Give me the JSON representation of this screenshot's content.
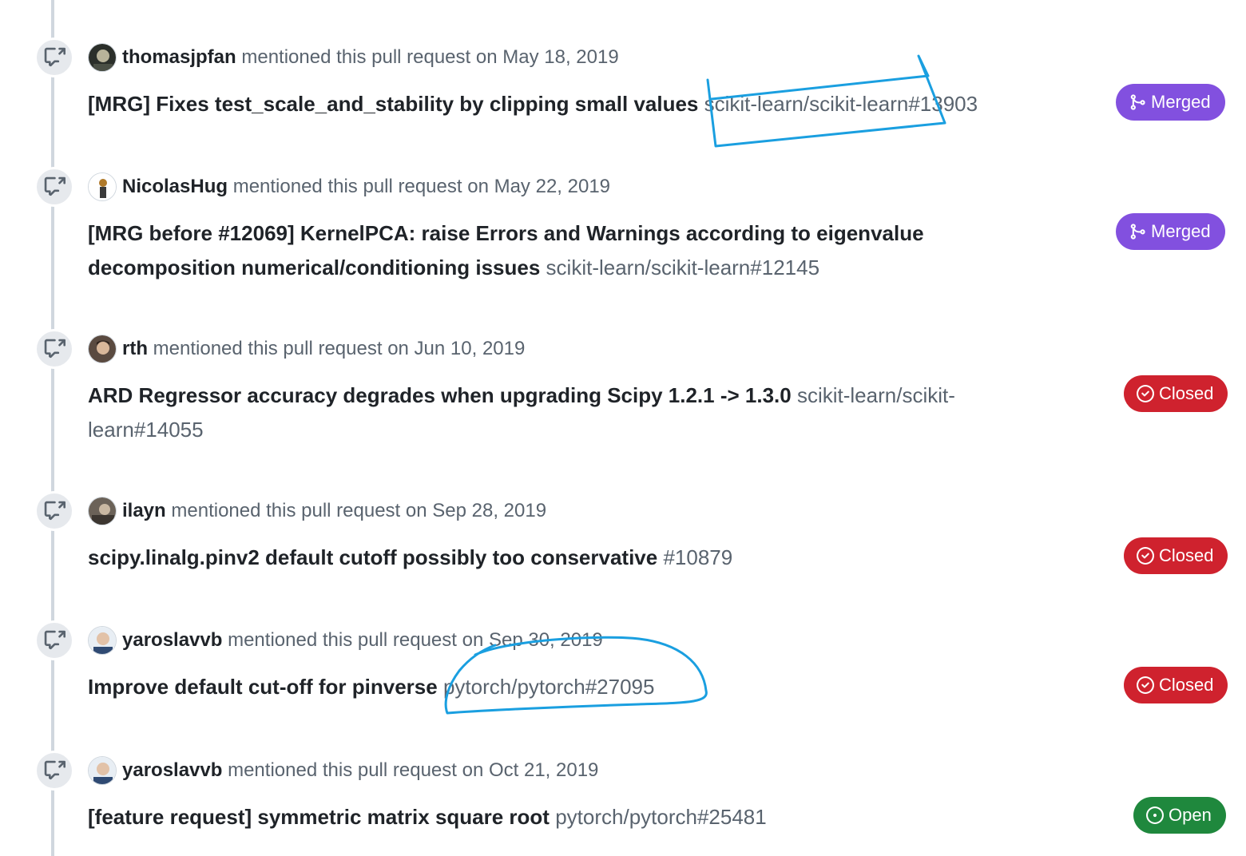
{
  "events": [
    {
      "author": "thomasjpfan",
      "action": "mentioned this pull request",
      "date": "on May 18, 2019",
      "title": "[MRG] Fixes test_scale_and_stability by clipping small values",
      "ref": "scikit-learn/scikit-learn#13903",
      "state": "Merged"
    },
    {
      "author": "NicolasHug",
      "action": "mentioned this pull request",
      "date": "on May 22, 2019",
      "title": "[MRG before #12069] KernelPCA: raise Errors and Warnings according to eigenvalue decomposition numerical/conditioning issues",
      "ref": "scikit-learn/scikit-learn#12145",
      "state": "Merged"
    },
    {
      "author": "rth",
      "action": "mentioned this pull request",
      "date": "on Jun 10, 2019",
      "title": "ARD Regressor accuracy degrades when upgrading Scipy 1.2.1 -> 1.3.0",
      "ref": "scikit-learn/scikit-learn#14055",
      "state": "Closed"
    },
    {
      "author": "ilayn",
      "action": "mentioned this pull request",
      "date": "on Sep 28, 2019",
      "title": "scipy.linalg.pinv2 default cutoff possibly too conservative",
      "ref": "#10879",
      "state": "Closed"
    },
    {
      "author": "yaroslavvb",
      "action": "mentioned this pull request",
      "date": "on Sep 30, 2019",
      "title": "Improve default cut-off for pinverse",
      "ref": "pytorch/pytorch#27095",
      "state": "Closed"
    },
    {
      "author": "yaroslavvb",
      "action": "mentioned this pull request",
      "date": "on Oct 21, 2019",
      "title": "[feature request] symmetric matrix square root",
      "ref": "pytorch/pytorch#25481",
      "state": "Open"
    }
  ],
  "icons": {
    "event": "cross-reference-icon",
    "merged": "git-merge-icon",
    "closed": "issue-closed-icon",
    "open": "issue-opened-icon"
  },
  "colors": {
    "merged": "#8250df",
    "closed": "#cf222e",
    "open": "#1f883d",
    "annotation": "#1a9fe0"
  }
}
